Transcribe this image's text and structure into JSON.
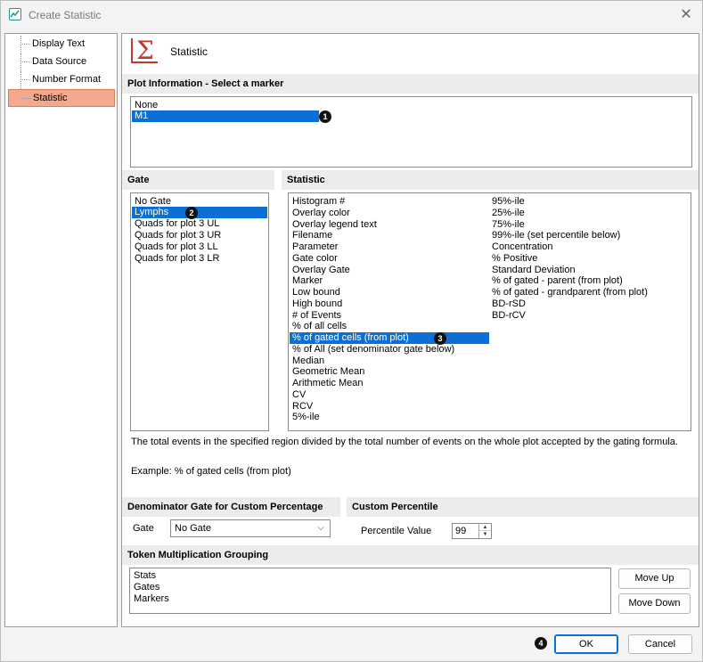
{
  "window": {
    "title": "Create Statistic",
    "close_glyph": "✕"
  },
  "sidebar": {
    "items": [
      {
        "label": "Display Text"
      },
      {
        "label": "Data Source"
      },
      {
        "label": "Number Format"
      },
      {
        "label": "Statistic"
      }
    ],
    "selected": "Statistic"
  },
  "header": {
    "icon_glyph": "Σ",
    "title": "Statistic"
  },
  "plot_info": {
    "heading": "Plot Information - Select a marker",
    "items": [
      "None",
      "M1"
    ],
    "selected": "M1",
    "badge": "1"
  },
  "gate": {
    "heading": "Gate",
    "items": [
      "No Gate",
      "Lymphs",
      "Quads for plot 3 UL",
      "Quads for plot 3 UR",
      "Quads for plot 3 LL",
      "Quads for plot 3 LR"
    ],
    "selected": "Lymphs",
    "badge": "2"
  },
  "statistic": {
    "heading": "Statistic",
    "col1": [
      "Histogram #",
      "Overlay color",
      "Overlay legend text",
      "Filename",
      "Parameter",
      "Gate color",
      "Overlay Gate",
      "Marker",
      "Low bound",
      "High bound",
      "# of Events",
      "% of all cells",
      "% of gated cells (from plot)",
      "% of All (set denominator gate below)",
      "Median",
      "Geometric Mean",
      "Arithmetic Mean",
      "CV",
      "RCV",
      "5%-ile"
    ],
    "col2": [
      "95%-ile",
      "25%-ile",
      "75%-ile",
      "99%-ile (set percentile below)",
      "Concentration",
      "% Positive",
      "Standard Deviation",
      "% of gated - parent (from plot)",
      "% of gated - grandparent (from plot)",
      "BD-rSD",
      "BD-rCV"
    ],
    "selected": "% of gated cells (from plot)",
    "badge": "3"
  },
  "description": {
    "text": "The total events in the specified region divided by the total number of events on the whole plot accepted by the gating formula.",
    "example": "Example: % of gated cells (from plot)"
  },
  "denominator": {
    "heading": "Denominator Gate for Custom Percentage",
    "label": "Gate",
    "value": "No Gate",
    "chevron": "⌵"
  },
  "percentile": {
    "heading": "Custom Percentile",
    "label": "Percentile Value",
    "value": "99",
    "up": "▲",
    "down": "▼"
  },
  "token": {
    "heading": "Token Multiplication Grouping",
    "items": [
      "Stats",
      "Gates",
      "Markers"
    ],
    "move_up": "Move Up",
    "move_down": "Move Down"
  },
  "footer": {
    "ok": "OK",
    "cancel": "Cancel",
    "badge": "4"
  },
  "colors": {
    "selection": "#0a6fd6",
    "sidebar_selected": "#f4a98e",
    "sigma": "#c0392b"
  }
}
